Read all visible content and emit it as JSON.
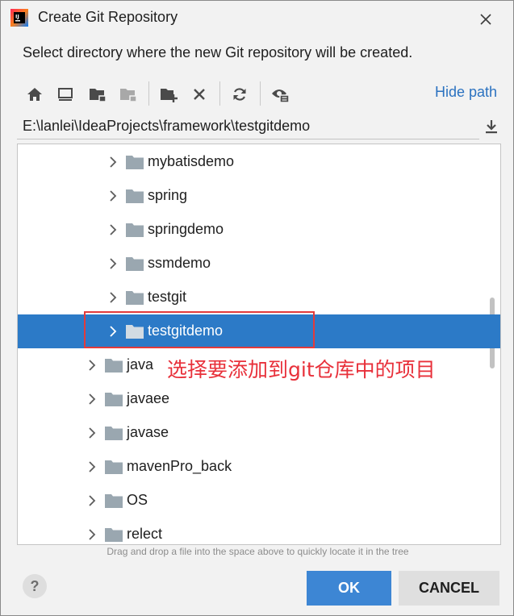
{
  "dialog": {
    "title": "Create Git Repository",
    "description": "Select directory where the new Git repository will be created."
  },
  "toolbar": {
    "icons": [
      "home-icon",
      "desktop-icon",
      "project-folder-icon",
      "module-folder-icon",
      "new-folder-icon",
      "delete-icon",
      "refresh-icon",
      "show-hidden-icon"
    ],
    "hide_path_label": "Hide path"
  },
  "path": {
    "value": "E:\\lanlei\\IdeaProjects\\framework\\testgitdemo"
  },
  "tree": {
    "rows": [
      {
        "label": "mybatisdemo",
        "selected": false
      },
      {
        "label": "spring",
        "selected": false
      },
      {
        "label": "springdemo",
        "selected": false
      },
      {
        "label": "ssmdemo",
        "selected": false
      },
      {
        "label": "testgit",
        "selected": false
      },
      {
        "label": "testgitdemo",
        "selected": true
      },
      {
        "label": "java",
        "selected": false
      },
      {
        "label": "javaee",
        "selected": false
      },
      {
        "label": "javase",
        "selected": false
      },
      {
        "label": "mavenPro_back",
        "selected": false
      },
      {
        "label": "OS",
        "selected": false
      },
      {
        "label": "relect",
        "selected": false
      }
    ]
  },
  "annotation": {
    "text": "选择要添加到git仓库中的项目",
    "color": "#e8303a"
  },
  "hint": "Drag and drop a file into the space above to quickly locate it in the tree",
  "footer": {
    "help_label": "?",
    "ok_label": "OK",
    "cancel_label": "CANCEL"
  },
  "colors": {
    "accent": "#2c7ac7",
    "ok_button": "#3d86d4",
    "link": "#2b72c0",
    "folder": "#9aa7b0"
  }
}
